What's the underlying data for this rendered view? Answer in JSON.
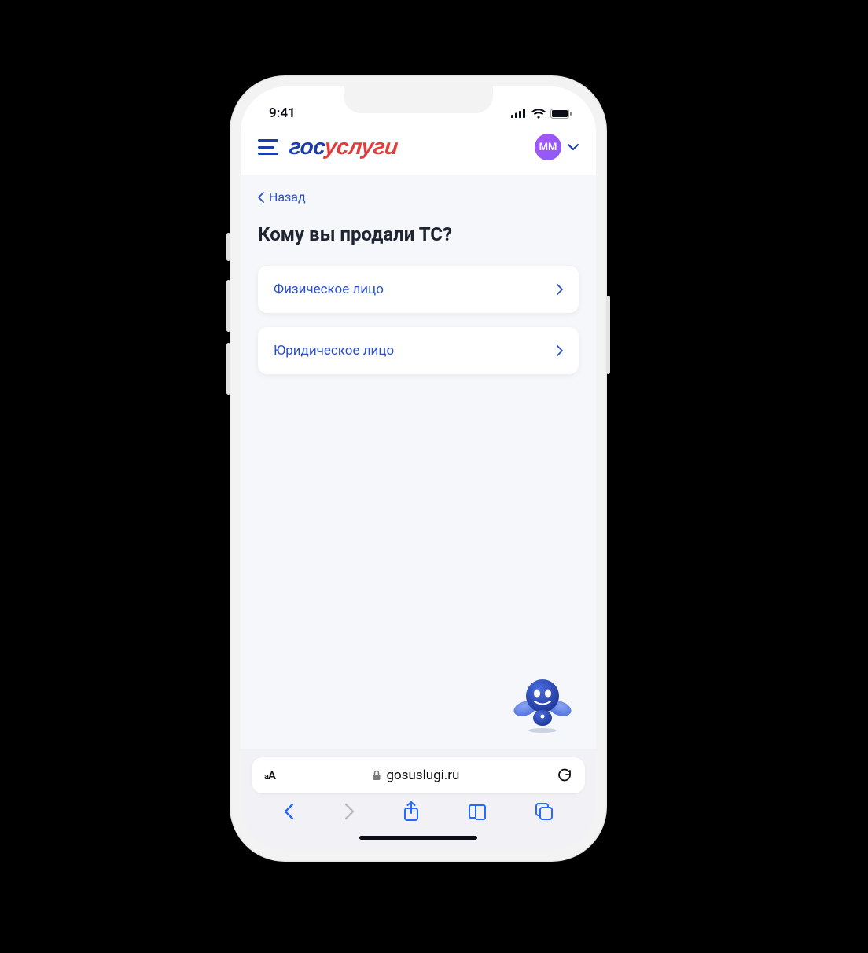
{
  "status": {
    "time": "9:41"
  },
  "header": {
    "logo_part1": "гос",
    "logo_part2": "услуги",
    "avatar_initials": "ММ"
  },
  "content": {
    "back_label": "Назад",
    "title": "Кому вы продали ТС?",
    "options": [
      {
        "label": "Физическое лицо"
      },
      {
        "label": "Юридическое лицо"
      }
    ]
  },
  "browser": {
    "text_size_label": "аА",
    "domain": "gosuslugi.ru"
  }
}
